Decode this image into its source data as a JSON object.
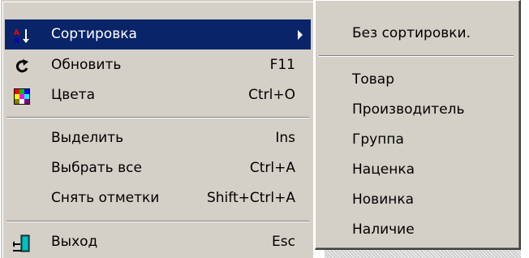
{
  "menu": {
    "items": [
      {
        "label": "Сортировка",
        "shortcut": "",
        "icon": "sort-az-icon",
        "has_submenu": true,
        "highlighted": true
      },
      {
        "label": "Обновить",
        "shortcut": "F11",
        "icon": "refresh-icon"
      },
      {
        "label": "Цвета",
        "shortcut": "Ctrl+O",
        "icon": "color-palette-icon"
      },
      {
        "label": "Выделить",
        "shortcut": "Ins"
      },
      {
        "label": "Выбрать все",
        "shortcut": "Ctrl+A"
      },
      {
        "label": "Снять отметки",
        "shortcut": "Shift+Ctrl+A"
      },
      {
        "label": "Выход",
        "shortcut": "Esc",
        "icon": "exit-door-icon"
      }
    ]
  },
  "submenu": {
    "items": [
      {
        "label": "Без сортировки."
      },
      {
        "label": "Товар"
      },
      {
        "label": "Производитель"
      },
      {
        "label": "Группа"
      },
      {
        "label": "Наценка"
      },
      {
        "label": "Новинка"
      },
      {
        "label": "Наличие"
      }
    ]
  },
  "colors": {
    "menu_background": "#d4d0c8",
    "highlight": "#0a246a",
    "highlight_text": "#ffffff"
  }
}
